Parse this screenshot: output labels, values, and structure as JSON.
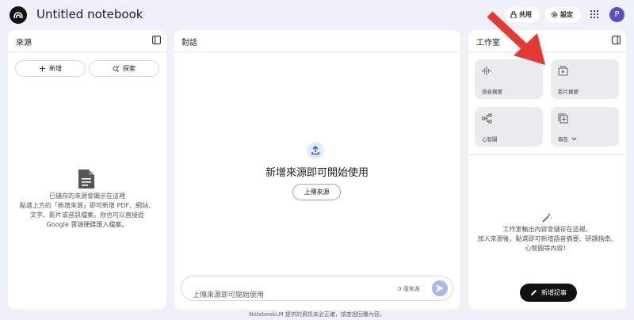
{
  "header": {
    "title": "Untitled notebook",
    "share_label": "共用",
    "settings_label": "設定",
    "avatar_initial": "P"
  },
  "sources": {
    "title": "來源",
    "add_label": "新增",
    "explore_label": "探索",
    "empty_lines": [
      "已儲存的來源會顯示在這裡",
      "點選上方的「新增來源」即可新增 PDF、網站、",
      "文字、影片或音訊檔案。你也可以直接從",
      "Google 雲端硬碟匯入檔案。"
    ]
  },
  "chat": {
    "title": "對話",
    "heading": "新增來源即可開始使用",
    "upload_label": "上傳來源",
    "input_placeholder": "上傳來源即可開始使用",
    "source_count": "0 個來源"
  },
  "studio": {
    "title": "工作室",
    "cards": [
      {
        "label": "語音摘要",
        "icon": "audio-waveform-icon"
      },
      {
        "label": "影片摘要",
        "icon": "video-icon"
      },
      {
        "label": "心智圖",
        "icon": "mind-map-icon"
      },
      {
        "label": "報告",
        "icon": "report-icon"
      }
    ],
    "empty_lines": [
      "工作室輸出內容會儲存在這裡。",
      "加入來源後，點選即可新增語音摘要、研讀指南、",
      "心智圖等內容！"
    ],
    "add_note_label": "新增記事"
  },
  "footer": {
    "text": "NotebookLM 提供的資訊未必正確，請查證回覆內容。"
  },
  "colors": {
    "background": "#eef0fa",
    "avatar": "#5b4ec9",
    "arrow": "#e53935",
    "send": "#a9b7ef"
  }
}
